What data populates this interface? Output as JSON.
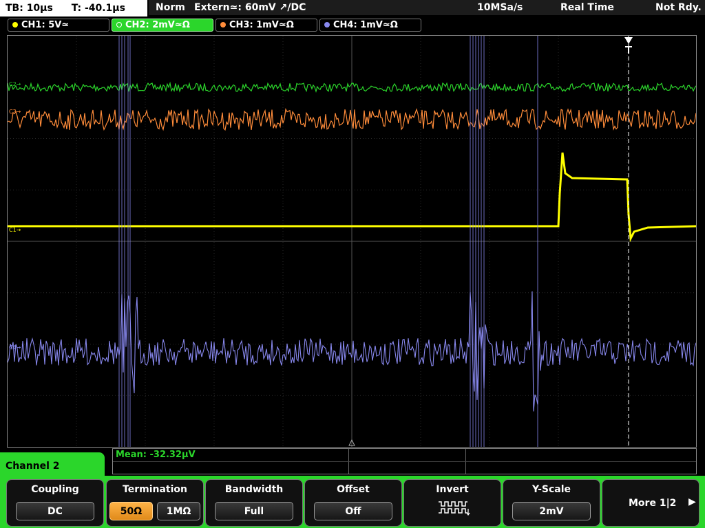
{
  "status": {
    "timebase": "TB: 10µs",
    "trigger_time": "T: -40.1µs",
    "mode": "Norm",
    "trigger_source": "Extern≃: 60mV ↗/DC",
    "sample_rate": "10MSa/s",
    "acq_mode": "Real Time",
    "ready": "Not Rdy."
  },
  "channels": [
    {
      "label": "CH1: 5V≃",
      "color": "#ffff00"
    },
    {
      "label": "CH2: 2mV≃Ω",
      "color": "#2bd62b"
    },
    {
      "label": "CH3: 1mV≃Ω",
      "color": "#ff8c3a"
    },
    {
      "label": "CH4: 1mV≃Ω",
      "color": "#8888ee"
    }
  ],
  "markers": {
    "c2": "C2→",
    "c3": "C3→",
    "c1": "C1→",
    "c4": "C4→"
  },
  "measurement": "Mean: -32.32µV",
  "channel_menu_title": "Channel 2",
  "softkeys": {
    "coupling": {
      "title": "Coupling",
      "value": "DC"
    },
    "termination": {
      "title": "Termination",
      "opt1": "50Ω",
      "opt2": "1MΩ"
    },
    "bandwidth": {
      "title": "Bandwidth",
      "value": "Full"
    },
    "offset": {
      "title": "Offset",
      "value": "Off"
    },
    "invert": {
      "title": "Invert",
      "icon": "invert-square-wave-icon"
    },
    "yscale": {
      "title": "Y-Scale",
      "value": "2mV"
    },
    "more": {
      "label": "More 1|2",
      "icon": "right-arrow-icon"
    }
  }
}
